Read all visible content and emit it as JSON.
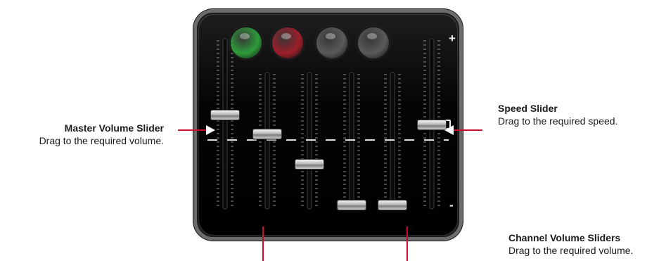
{
  "callouts": {
    "master": {
      "title": "Master Volume Slider",
      "desc": "Drag to the required volume."
    },
    "speed": {
      "title": "Speed Slider",
      "desc": "Drag to the required speed."
    },
    "channel": {
      "title": "Channel Volume Sliders",
      "desc": "Drag to the required volume."
    }
  },
  "mixer": {
    "speed_marks": {
      "plus": "+",
      "minus": "-"
    },
    "knobs": [
      {
        "name": "knob-green",
        "color": "#2e9c3b"
      },
      {
        "name": "knob-red",
        "color": "#9d1f2a"
      },
      {
        "name": "knob-gray-1",
        "color": "#5a5a5a"
      },
      {
        "name": "knob-gray-2",
        "color": "#5a5a5a"
      }
    ],
    "sliders": [
      {
        "name": "master-volume-slider",
        "level": 0.56
      },
      {
        "name": "channel-1-volume-slider",
        "level": 0.56
      },
      {
        "name": "channel-2-volume-slider",
        "level": 0.32
      },
      {
        "name": "channel-3-volume-slider",
        "level": 0.0
      },
      {
        "name": "channel-4-volume-slider",
        "level": 0.0
      },
      {
        "name": "speed-slider",
        "level": 0.5
      }
    ]
  },
  "colors": {
    "accent": "#c8102e"
  }
}
